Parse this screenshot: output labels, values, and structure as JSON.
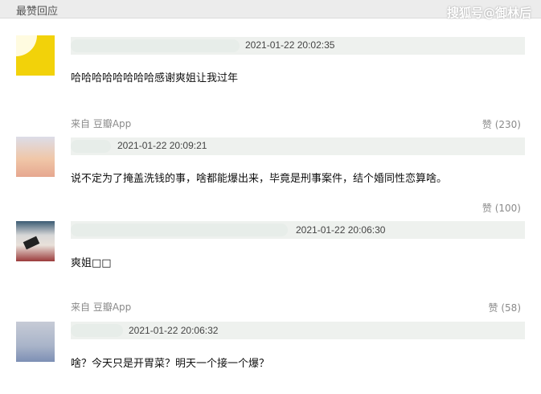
{
  "header": {
    "title": "最赞回应",
    "watermark": "搜狐号@御林后"
  },
  "comments": [
    {
      "timestamp": "2021-01-22 20:02:35",
      "text": "哈哈哈哈哈哈哈哈感谢爽姐让我过年",
      "source": "来自 豆瓣App",
      "likes": "赞 (230)"
    },
    {
      "timestamp": "2021-01-22 20:09:21",
      "text": "说不定为了掩盖洗钱的事，啥都能爆出来，毕竟是刑事案件，结个婚同性恋算啥。",
      "source": "",
      "likes": "赞 (100)"
    },
    {
      "timestamp": "2021-01-22 20:06:30",
      "text": "爽姐□□",
      "source": "来自 豆瓣App",
      "likes": "赞 (58)"
    },
    {
      "timestamp": "2021-01-22 20:06:32",
      "text": "啥？今天只是开胃菜？明天一个接一个爆？",
      "source": "",
      "likes": ""
    }
  ],
  "colors": {
    "topbar": "#ececec",
    "namebar": "#eef1ee",
    "muted": "#8a8a8a"
  }
}
